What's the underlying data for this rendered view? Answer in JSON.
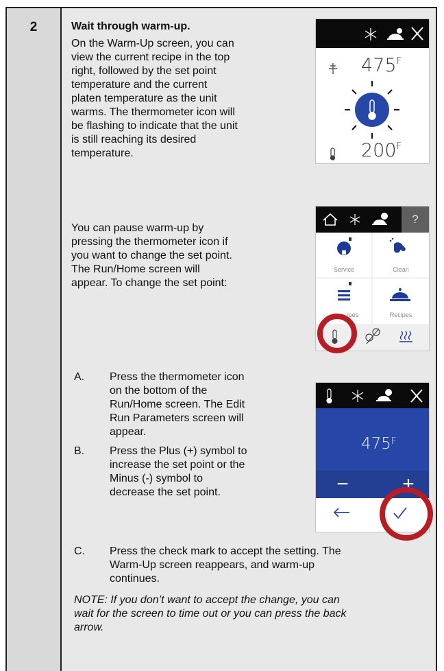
{
  "step": {
    "number": "2",
    "title": "Wait through warm-up.",
    "para1": [
      "On the Warm-Up screen, you can",
      "view the current recipe in the top",
      "right, followed by the set point",
      "temperature and the current",
      "platen temperature as the unit",
      "warms. The thermometer icon will",
      "be flashing to indicate that the unit",
      "is still reaching its desired",
      "temperature."
    ],
    "para2": [
      "You can pause warm-up by",
      "pressing the thermometer icon if",
      "you want to change the set point.",
      "The Run/Home screen will",
      "appear. To change the set point:"
    ],
    "item_a": {
      "letter": "A.",
      "lines": [
        "Press the thermometer icon",
        "on the bottom of the",
        "Run/Home screen. The Edit",
        "Run Parameters screen will",
        "appear."
      ]
    },
    "item_b": {
      "letter": "B.",
      "lines": [
        "Press the Plus (+) symbol to",
        "increase the set point or the",
        "Minus (-) symbol to",
        "decrease the set point."
      ]
    },
    "item_c": {
      "letter": "C.",
      "lines": [
        "Press the check mark to accept the setting. The",
        "Warm-Up screen reappears, and warm-up",
        "continues."
      ]
    },
    "note": [
      "NOTE: If you don’t want to accept the change, you can",
      "wait for the screen to time out or you can press the back",
      "arrow."
    ]
  },
  "screen_warmup": {
    "set_point": "475",
    "current_temp": "200",
    "unit": "F",
    "icons": [
      "snowflake-icon",
      "recipe-icon",
      "close-icon",
      "setpoint-thermometer-icon",
      "thermometer-icon"
    ]
  },
  "screen_home": {
    "help": "?",
    "tiles": [
      "Service",
      "Clean",
      "Recipes"
    ],
    "partial_label": "ipes",
    "icons": [
      "home-icon",
      "snowflake-icon",
      "recipe-icon",
      "help-icon",
      "service-icon",
      "clean-icon",
      "recipes-list-icon",
      "recipes-icon",
      "thermometer-icon",
      "no-gap-icon",
      "heat-icon"
    ]
  },
  "screen_edit": {
    "value": "475",
    "unit": "F",
    "minus": "−",
    "plus": "+",
    "icons": [
      "thermometer-icon",
      "snowflake-icon",
      "recipe-icon",
      "close-icon",
      "back-arrow-icon",
      "check-icon"
    ],
    "panel_color": "#2747a8"
  },
  "colors": {
    "highlight_ring": "#b81d25",
    "accent_blue": "#2747a8",
    "side_col": "#d9d9d9"
  }
}
